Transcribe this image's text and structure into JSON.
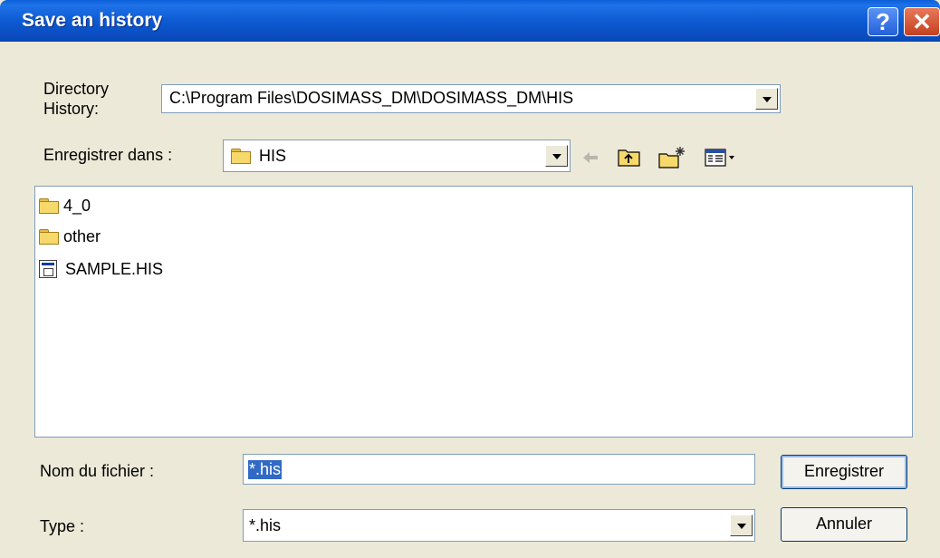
{
  "window": {
    "title": "Save an history",
    "help_glyph": "?",
    "close_glyph": "✕"
  },
  "directory_history": {
    "label_line1": "Directory",
    "label_line2": "History:",
    "value": "C:\\Program Files\\DOSIMASS_DM\\DOSIMASS_DM\\HIS"
  },
  "save_in": {
    "label": "Enregistrer dans :",
    "value": "HIS"
  },
  "toolbar": {
    "back_icon": "back-arrow-icon",
    "up_icon": "up-folder-icon",
    "new_folder_icon": "new-folder-icon",
    "view_icon": "view-menu-icon"
  },
  "files": [
    {
      "name": "4_0",
      "icon": "folder-icon"
    },
    {
      "name": "other",
      "icon": "folder-icon"
    },
    {
      "name": "SAMPLE.HIS",
      "icon": "history-file-icon"
    }
  ],
  "filename": {
    "label": "Nom du fichier :",
    "value": "*.his"
  },
  "filetype": {
    "label": "Type :",
    "value": "*.his"
  },
  "buttons": {
    "save": "Enregistrer",
    "cancel": "Annuler"
  },
  "colors": {
    "title_bar": "#0a58d0",
    "dialog_bg": "#ece9d8",
    "selection": "#316ac5"
  }
}
